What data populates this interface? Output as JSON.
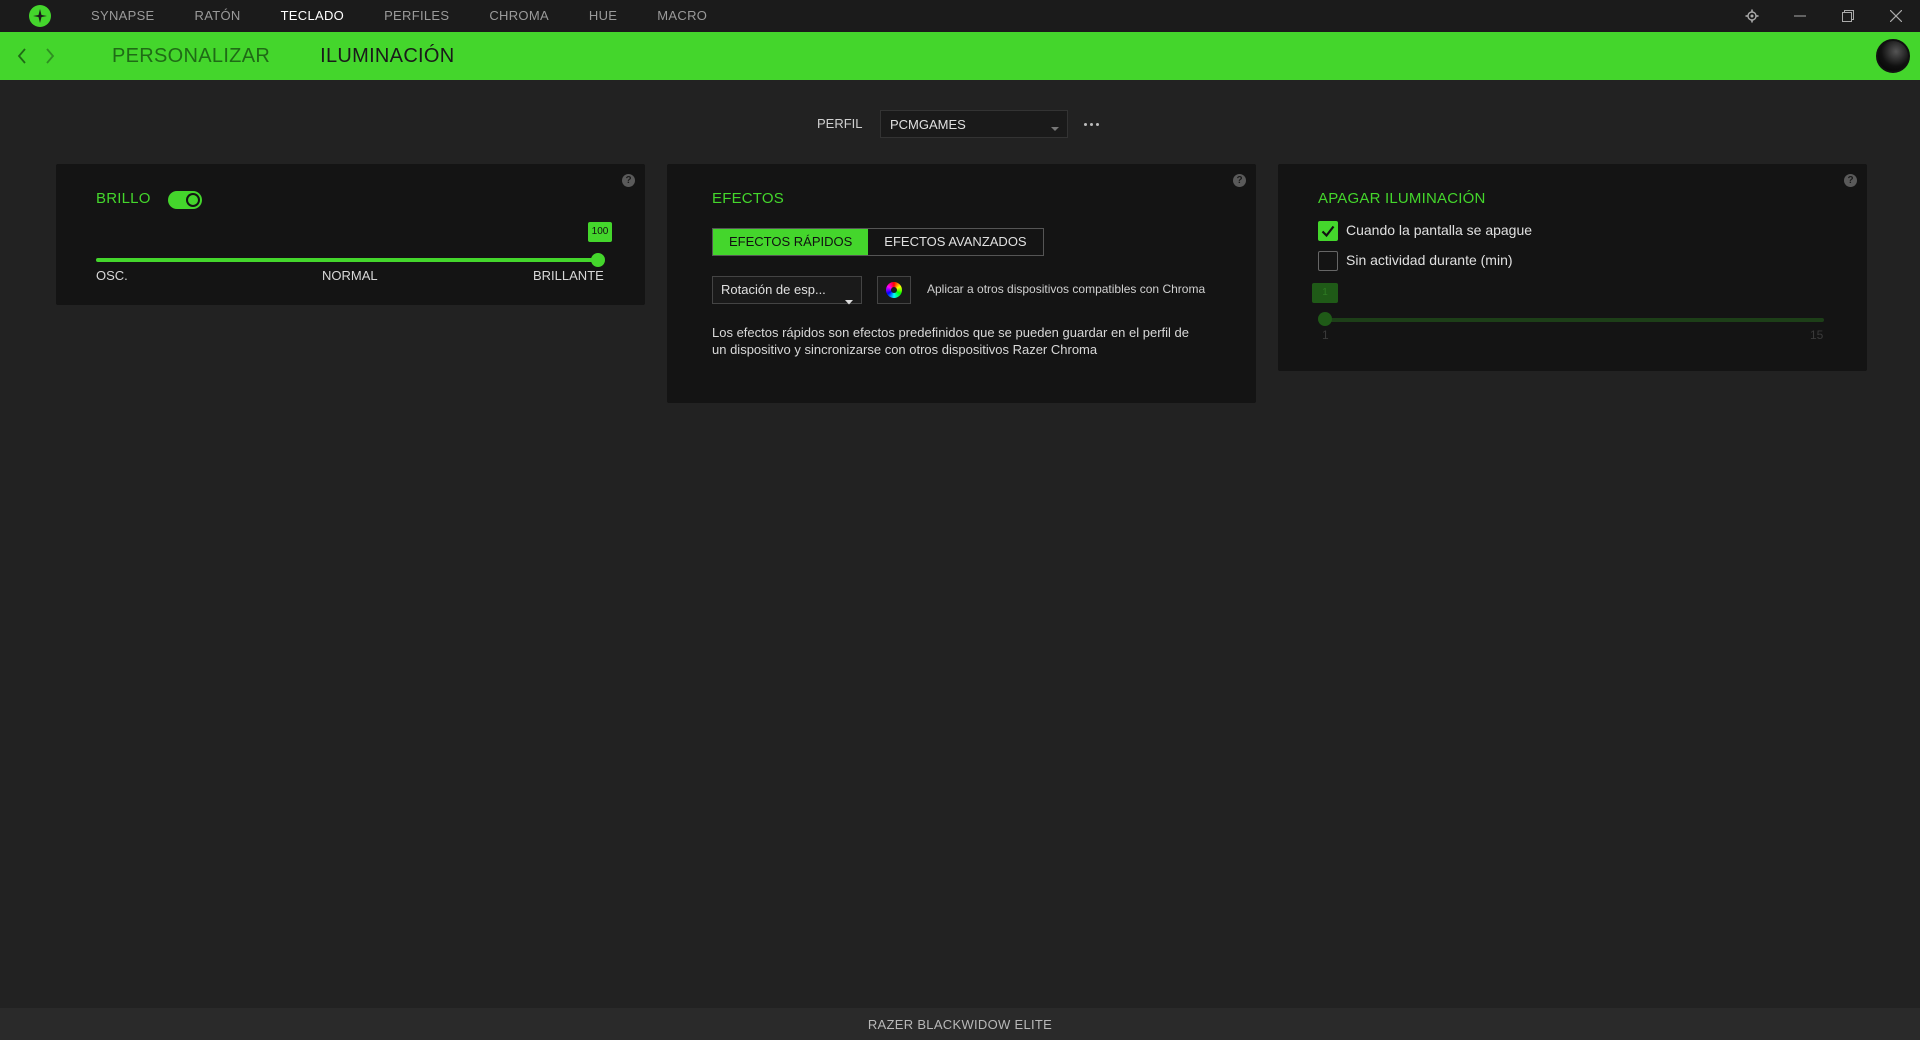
{
  "topnav": {
    "items": [
      "SYNAPSE",
      "RATÓN",
      "TECLADO",
      "PERFILES",
      "CHROMA",
      "HUE",
      "MACRO"
    ],
    "active_index": 2
  },
  "breadcrumb": {
    "parent": "PERSONALIZAR",
    "current": "ILUMINACIÓN"
  },
  "profile": {
    "label": "PERFIL",
    "selected": "PCMGAMES"
  },
  "brightness": {
    "title": "BRILLO",
    "enabled": true,
    "value": 100,
    "value_label": "100",
    "min_label": "OSC.",
    "mid_label": "NORMAL",
    "max_label": "BRILLANTE"
  },
  "effects": {
    "title": "EFECTOS",
    "tabs": [
      "EFECTOS RÁPIDOS",
      "EFECTOS AVANZADOS"
    ],
    "active_tab": 0,
    "selected_effect": "Rotación de esp...",
    "apply_text": "Aplicar a otros dispositivos compatibles con Chroma",
    "description": "Los efectos rápidos son efectos predefinidos que se pueden guardar en el perfil de un dispositivo y sincronizarse con otros dispositivos Razer Chroma"
  },
  "lighting_off": {
    "title": "APAGAR ILUMINACIÓN",
    "option1": {
      "label": "Cuando la pantalla se apague",
      "checked": true
    },
    "option2": {
      "label": "Sin actividad durante (min)",
      "checked": false
    },
    "slider_value": "1",
    "slider_min": "1",
    "slider_max": "15"
  },
  "help_glyph": "?",
  "device_name": "RAZER BLACKWIDOW ELITE",
  "colors": {
    "accent": "#44d62c",
    "background": "#222222",
    "panel": "#141414"
  }
}
